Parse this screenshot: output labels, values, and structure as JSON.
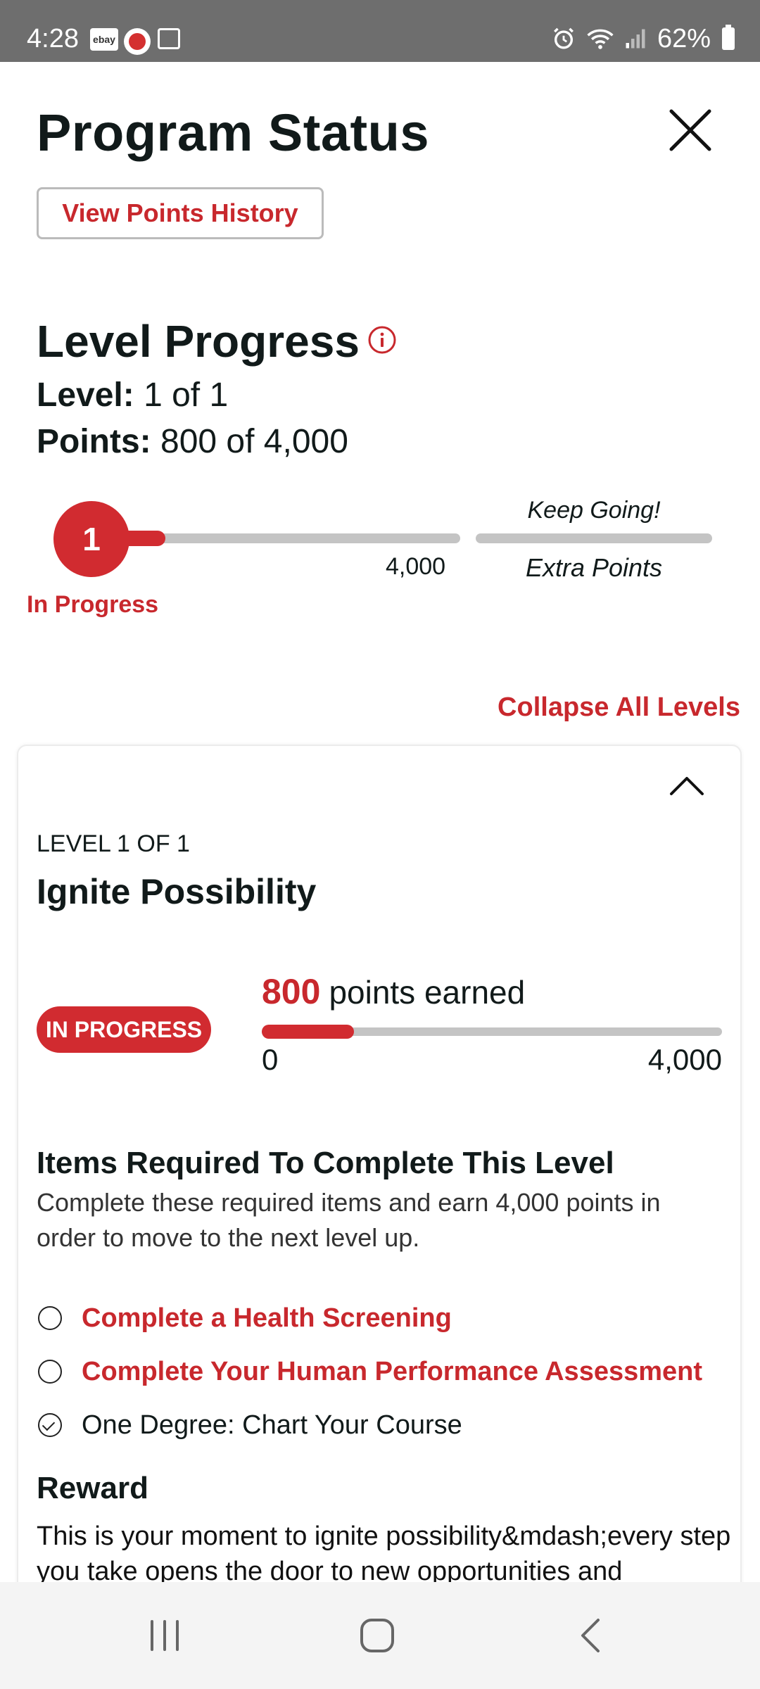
{
  "status_bar": {
    "time": "4:28",
    "notification_icons": [
      "ebay-icon",
      "vpn-shield-icon",
      "gallery-icon"
    ],
    "ebay_label": "ebay",
    "right_icons": [
      "alarm-icon",
      "wifi-icon",
      "signal-icon",
      "battery-icon"
    ],
    "battery_pct": "62%"
  },
  "header": {
    "title": "Program Status",
    "close_icon": "close-icon",
    "history_button": "View Points History"
  },
  "level_progress": {
    "title": "Level Progress",
    "info_icon": "info-icon",
    "level_label": "Level:",
    "level_value": "1 of 1",
    "points_label": "Points:",
    "points_value": "800 of 4,000",
    "current_level_number": "1",
    "level_max_label": "4,000",
    "progress_fraction": 0.2,
    "status_label": "In Progress",
    "extra_top": "Keep Going!",
    "extra_bottom": "Extra Points"
  },
  "collapse_all": "Collapse All Levels",
  "level_card": {
    "eyebrow": "LEVEL 1 OF 1",
    "name": "Ignite Possibility",
    "badge": "IN PROGRESS",
    "points_earned": "800",
    "points_earned_suffix": "points earned",
    "range_min": "0",
    "range_max": "4,000",
    "progress_fraction": 0.2,
    "required_title": "Items Required To Complete This Level",
    "required_desc": "Complete these required items and earn 4,000 points in order to move to the next level up.",
    "required_items": [
      {
        "label": "Complete a Health Screening",
        "completed": false
      },
      {
        "label": "Complete Your Human Performance Assessment",
        "completed": false
      },
      {
        "label": "One Degree: Chart Your Course",
        "completed": true
      }
    ],
    "reward_title": "Reward",
    "reward_text": "This is your moment to ignite possibility&mdash;every step you take opens the door to new opportunities and"
  },
  "colors": {
    "accent": "#d12b30",
    "track": "#c4c4c4",
    "statusbar": "#6e6e6e",
    "navbar": "#f4f4f4"
  },
  "nav": [
    "recents-icon",
    "home-icon",
    "back-icon"
  ]
}
